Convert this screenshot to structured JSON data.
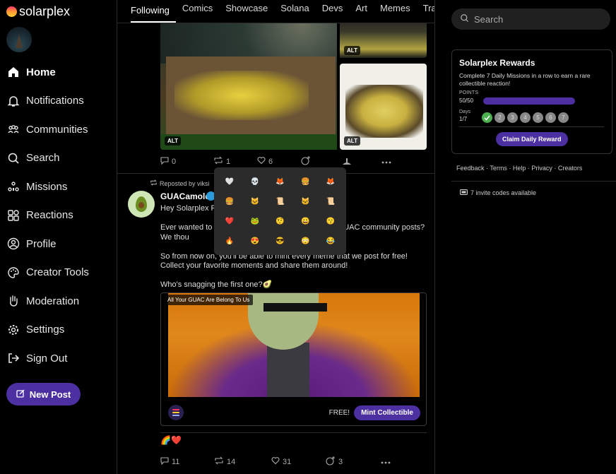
{
  "brand": {
    "name": "solarplex"
  },
  "nav": {
    "items": [
      {
        "label": "Home",
        "icon": "home-icon"
      },
      {
        "label": "Notifications",
        "icon": "bell-icon"
      },
      {
        "label": "Communities",
        "icon": "users-icon"
      },
      {
        "label": "Search",
        "icon": "search-icon"
      },
      {
        "label": "Missions",
        "icon": "missions-icon"
      },
      {
        "label": "Reactions",
        "icon": "reactions-icon"
      },
      {
        "label": "Profile",
        "icon": "profile-icon"
      },
      {
        "label": "Creator Tools",
        "icon": "palette-icon"
      },
      {
        "label": "Moderation",
        "icon": "hand-icon"
      },
      {
        "label": "Settings",
        "icon": "gear-icon"
      },
      {
        "label": "Sign Out",
        "icon": "sign-out-icon"
      }
    ],
    "new_post": "New Post"
  },
  "tabs": [
    "Following",
    "Comics",
    "Showcase",
    "Solana",
    "Devs",
    "Art",
    "Memes",
    "Trad"
  ],
  "post1": {
    "alt_labels": [
      "ALT",
      "ALT",
      "ALT"
    ],
    "replies": "0",
    "reposts": "1",
    "likes": "6"
  },
  "post2": {
    "repost_label": "Reposted by viksi",
    "author": "GUACamole",
    "text": [
      "Hey Solarplex F",
      "Ever wanted to                                                  the $GUAC community posts? We thou",
      "So from now on, you'll be able to mint every meme that we post for free! Collect your favorite moments and share them around!",
      "Who's snagging the first one?🥑"
    ],
    "nft_title": "All Your GUAC Are Belong To Us",
    "free": "FREE!",
    "mint": "Mint Collectible",
    "reactions_row": "🌈❤️",
    "replies": "11",
    "reposts": "14",
    "likes": "31",
    "reactions": "3"
  },
  "emoji_picker": {
    "emojis": [
      "🤍",
      "💀",
      "🦊",
      "🍔",
      "🦊",
      "🍔",
      "🐱",
      "📜",
      "🐱",
      "📜",
      "❤️",
      "🐸",
      "🤨",
      "😀",
      "😙",
      "🔥",
      "😍",
      "😎",
      "😳",
      "😂"
    ]
  },
  "search": {
    "placeholder": "Search"
  },
  "rewards": {
    "title": "Solarplex Rewards",
    "desc": "Complete 7 Daily Missions in a row to earn a rare collectible reaction!",
    "points_label": "POINTS",
    "points_value": "50/50",
    "points_progress": 1.0,
    "days_label": "Days",
    "days_value": "1/7",
    "day_numbers": [
      "2",
      "3",
      "4",
      "5",
      "6",
      "7"
    ],
    "claim": "Claim Daily Reward"
  },
  "footer_links": [
    "Feedback",
    "Terms",
    "Help",
    "Privacy",
    "Creators"
  ],
  "invites": "7 invite codes available",
  "colors": {
    "accent": "#4c2fa0",
    "background": "#000000",
    "success": "#4caf50"
  }
}
